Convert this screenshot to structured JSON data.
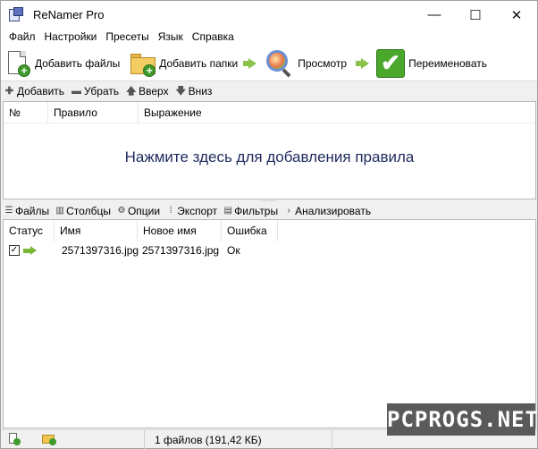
{
  "window": {
    "title": "ReNamer Pro",
    "controls": {
      "minimize": "—",
      "maximize": "☐",
      "close": "✕"
    }
  },
  "menu": [
    "Файл",
    "Настройки",
    "Пресеты",
    "Язык",
    "Справка"
  ],
  "toolbar": {
    "add_files": "Добавить файлы",
    "add_folders": "Добавить папки",
    "preview": "Просмотр",
    "rename": "Переименовать"
  },
  "rules_toolbar": {
    "add": "Добавить",
    "remove": "Убрать",
    "up": "Вверх",
    "down": "Вниз"
  },
  "rules_table": {
    "headers": [
      "№",
      "Правило",
      "Выражение"
    ],
    "hint": "Нажмите здесь для добавления правила"
  },
  "files_toolbar": {
    "files": "Файлы",
    "columns": "Столбцы",
    "options": "Опции",
    "export": "Экспорт",
    "filters": "Фильтры",
    "analyze": "Анализировать"
  },
  "files_table": {
    "headers": [
      "Статус",
      "Имя",
      "Новое имя",
      "Ошибка"
    ],
    "rows": [
      {
        "checked": true,
        "name": "2571397316.jpg",
        "new_name": "2571397316.jpg",
        "error": "Ок"
      }
    ]
  },
  "statusbar": {
    "summary": "1 файлов (191,42 КБ)"
  },
  "watermark": "PCPROGS.NET",
  "colors": {
    "hint_text": "#1f2a5e",
    "accent_green": "#4aa82c"
  }
}
